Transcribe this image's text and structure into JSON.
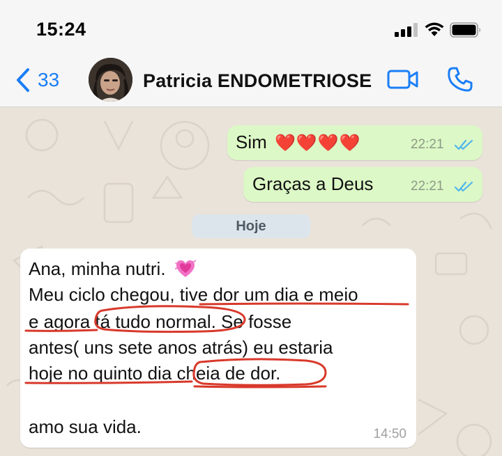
{
  "status_bar": {
    "time": "15:24"
  },
  "header": {
    "back_count": "33",
    "contact_name": "Patricia ENDOMETRIOSE"
  },
  "messages_out": [
    {
      "text": "Sim",
      "emoji": "❤️❤️❤️❤️",
      "time": "22:21",
      "status": "read"
    },
    {
      "text": "Graças a Deus",
      "time": "22:21",
      "status": "read"
    }
  ],
  "date_separator": "Hoje",
  "message_in": {
    "lines": [
      "Ana, minha nutri.",
      "Meu ciclo chegou, tive dor um dia e meio",
      "e agora tá tudo normal. Se fosse",
      "antes( uns sete anos atrás) eu estaria",
      "hoje no quinto dia cheia de dor.",
      "amo sua vida."
    ],
    "emoji": "💓",
    "time": "14:50"
  },
  "colors": {
    "accent_blue": "#1a7ef6",
    "outgoing_bubble": "#dcf8c6",
    "incoming_bubble": "#ffffff",
    "annotation_red": "#d8392b",
    "read_ticks": "#4fb6ec"
  }
}
